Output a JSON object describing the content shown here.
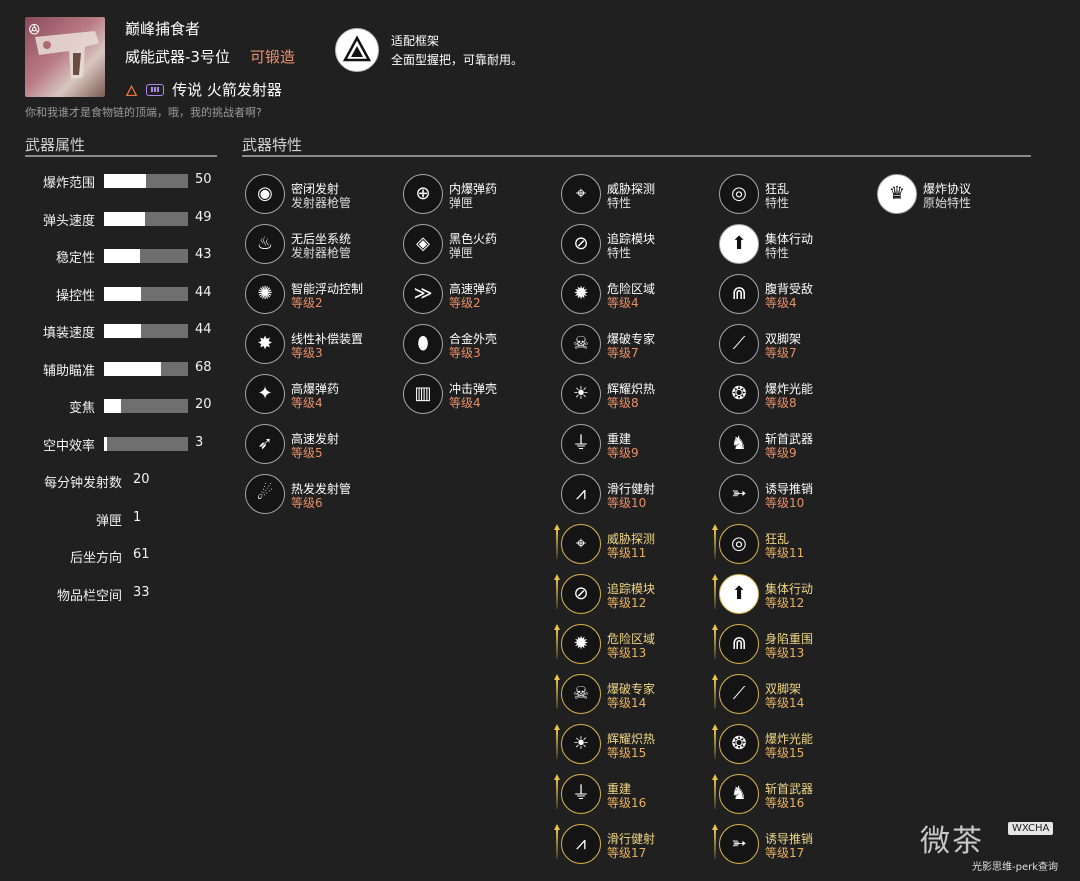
{
  "weapon": {
    "name": "巅峰捕食者",
    "slot": "威能武器-3号位",
    "craftable": "可锻造",
    "type": "传说 火箭发射器",
    "flavor": "你和我谁才是食物链的顶端，哦，我的挑战者啊?",
    "forge_mark": "ꔮ"
  },
  "frame": {
    "title": "适配框架",
    "desc": "全面型握把，可靠耐用。"
  },
  "sections": {
    "stats_title": "武器属性",
    "perks_title": "武器特性"
  },
  "stats_bars": [
    {
      "label": "爆炸范围",
      "value": 50
    },
    {
      "label": "弹头速度",
      "value": 49
    },
    {
      "label": "稳定性",
      "value": 43
    },
    {
      "label": "操控性",
      "value": 44
    },
    {
      "label": "填装速度",
      "value": 44
    },
    {
      "label": "辅助瞄准",
      "value": 68
    },
    {
      "label": "变焦",
      "value": 20
    },
    {
      "label": "空中效率",
      "value": 3
    }
  ],
  "stats_plain": [
    {
      "label": "每分钟发射数",
      "value": "20"
    },
    {
      "label": "弹匣",
      "value": "1"
    },
    {
      "label": "后坐方向",
      "value": "61"
    },
    {
      "label": "物品栏空间",
      "value": "33"
    }
  ],
  "perk_columns": [
    [
      {
        "name": "密闭发射",
        "sub": "发射器枪管",
        "icon": "barrel-icon",
        "glyph": "◉"
      },
      {
        "name": "无后坐系统",
        "sub": "发射器枪管",
        "icon": "flame-barrel-icon",
        "glyph": "♨"
      },
      {
        "name": "智能浮动控制",
        "sub": "等级2",
        "icon": "float-icon",
        "glyph": "✺"
      },
      {
        "name": "线性补偿装置",
        "sub": "等级3",
        "icon": "compensator-icon",
        "glyph": "✸"
      },
      {
        "name": "高爆弹药",
        "sub": "等级4",
        "icon": "explosive-icon",
        "glyph": "✦"
      },
      {
        "name": "高速发射",
        "sub": "等级5",
        "icon": "speed-icon",
        "glyph": "➶"
      },
      {
        "name": "热发发射管",
        "sub": "等级6",
        "icon": "hot-barrel-icon",
        "glyph": "☄"
      }
    ],
    [
      {
        "name": "内爆弹药",
        "sub": "弹匣",
        "icon": "implosion-icon",
        "glyph": "⊕"
      },
      {
        "name": "黑色火药",
        "sub": "弹匣",
        "icon": "black-powder-icon",
        "glyph": "◈"
      },
      {
        "name": "高速弹药",
        "sub": "等级2",
        "icon": "velocity-icon",
        "glyph": "≫"
      },
      {
        "name": "合金外壳",
        "sub": "等级3",
        "icon": "alloy-icon",
        "glyph": "⬮"
      },
      {
        "name": "冲击弹壳",
        "sub": "等级4",
        "icon": "impact-icon",
        "glyph": "▥"
      }
    ],
    [
      {
        "name": "威胁探测",
        "sub": "特性",
        "icon": "threat-icon",
        "glyph": "⌖"
      },
      {
        "name": "追踪模块",
        "sub": "特性",
        "icon": "tracking-icon",
        "glyph": "⊘"
      },
      {
        "name": "危险区域",
        "sub": "等级4",
        "icon": "danger-icon",
        "glyph": "✹"
      },
      {
        "name": "爆破专家",
        "sub": "等级7",
        "icon": "demolition-icon",
        "glyph": "☠"
      },
      {
        "name": "辉耀炽热",
        "sub": "等级8",
        "icon": "radiant-icon",
        "glyph": "☀"
      },
      {
        "name": "重建",
        "sub": "等级9",
        "icon": "rebuild-icon",
        "glyph": "⏚"
      },
      {
        "name": "滑行健射",
        "sub": "等级10",
        "icon": "glide-icon",
        "glyph": "⩘"
      },
      {
        "name": "威胁探测",
        "sub": "等级11",
        "icon": "threat-icon",
        "glyph": "⌖",
        "enhanced": true
      },
      {
        "name": "追踪模块",
        "sub": "等级12",
        "icon": "tracking-icon",
        "glyph": "⊘",
        "enhanced": true
      },
      {
        "name": "危险区域",
        "sub": "等级13",
        "icon": "danger-icon",
        "glyph": "✹",
        "enhanced": true
      },
      {
        "name": "爆破专家",
        "sub": "等级14",
        "icon": "demolition-icon",
        "glyph": "☠",
        "enhanced": true
      },
      {
        "name": "辉耀炽热",
        "sub": "等级15",
        "icon": "radiant-icon",
        "glyph": "☀",
        "enhanced": true
      },
      {
        "name": "重建",
        "sub": "等级16",
        "icon": "rebuild-icon",
        "glyph": "⏚",
        "enhanced": true
      },
      {
        "name": "滑行健射",
        "sub": "等级17",
        "icon": "glide-icon",
        "glyph": "⩘",
        "enhanced": true
      }
    ],
    [
      {
        "name": "狂乱",
        "sub": "特性",
        "icon": "frenzy-icon",
        "glyph": "◎"
      },
      {
        "name": "集体行动",
        "sub": "特性",
        "icon": "collective-icon",
        "glyph": "⬆",
        "white": true
      },
      {
        "name": "腹背受敌",
        "sub": "等级4",
        "icon": "surrounded-icon",
        "glyph": "⋒"
      },
      {
        "name": "双脚架",
        "sub": "等级7",
        "icon": "bipod-icon",
        "glyph": "⟋"
      },
      {
        "name": "爆炸光能",
        "sub": "等级8",
        "icon": "explosive-light-icon",
        "glyph": "❂"
      },
      {
        "name": "斩首武器",
        "sub": "等级9",
        "icon": "executioner-icon",
        "glyph": "♞"
      },
      {
        "name": "诱导推销",
        "sub": "等级10",
        "icon": "guided-icon",
        "glyph": "➳"
      },
      {
        "name": "狂乱",
        "sub": "等级11",
        "icon": "frenzy-icon",
        "glyph": "◎",
        "enhanced": true
      },
      {
        "name": "集体行动",
        "sub": "等级12",
        "icon": "collective-icon",
        "glyph": "⬆",
        "enhanced": true,
        "white": true
      },
      {
        "name": "身陷重围",
        "sub": "等级13",
        "icon": "surrounded-icon",
        "glyph": "⋒",
        "enhanced": true
      },
      {
        "name": "双脚架",
        "sub": "等级14",
        "icon": "bipod-icon",
        "glyph": "⟋",
        "enhanced": true
      },
      {
        "name": "爆炸光能",
        "sub": "等级15",
        "icon": "explosive-light-icon",
        "glyph": "❂",
        "enhanced": true
      },
      {
        "name": "斩首武器",
        "sub": "等级16",
        "icon": "executioner-icon",
        "glyph": "♞",
        "enhanced": true
      },
      {
        "name": "诱导推销",
        "sub": "等级17",
        "icon": "guided-icon",
        "glyph": "➳",
        "enhanced": true
      }
    ],
    [
      {
        "name": "爆炸协议",
        "sub": "原始特性",
        "icon": "explosive-protocol-icon",
        "glyph": "♛",
        "white": true
      }
    ]
  ],
  "watermark": {
    "main": "微茶",
    "badge": "WXCHA",
    "sub": "光影思维-perk查询"
  }
}
